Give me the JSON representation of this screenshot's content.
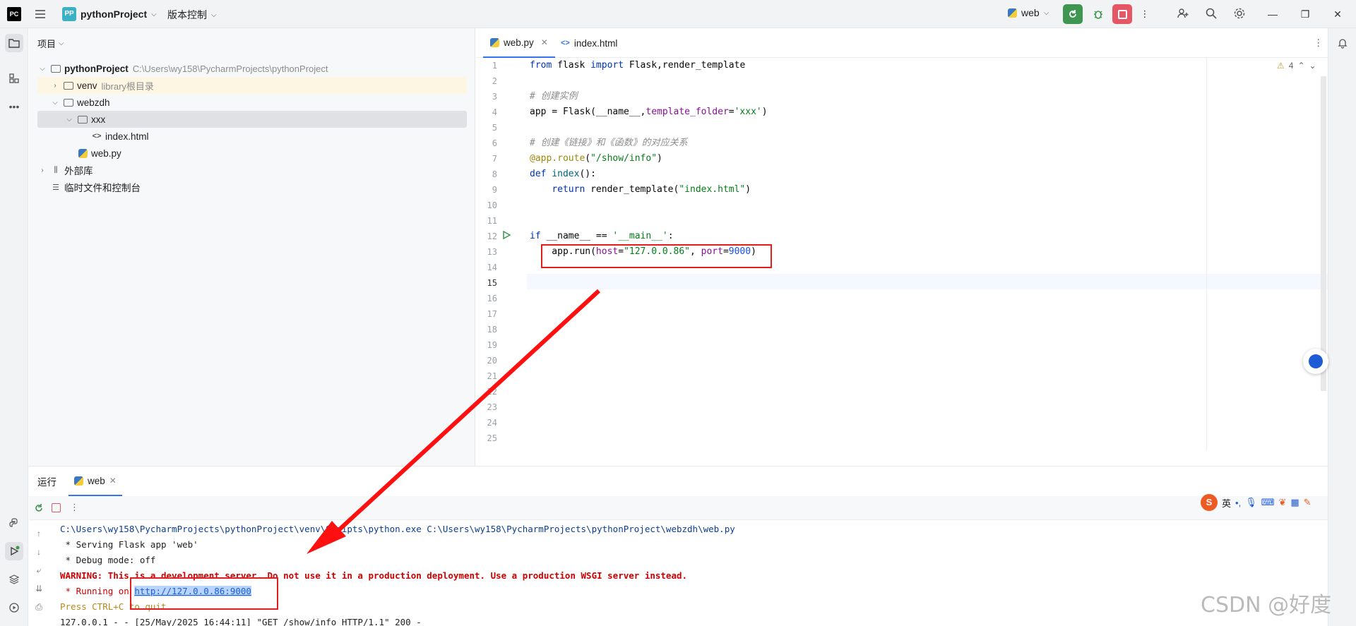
{
  "titlebar": {
    "logo": "PC",
    "project_badge": "PP",
    "project_name": "pythonProject",
    "vcs_label": "版本控制",
    "run_config": "web"
  },
  "project_panel": {
    "header": "项目",
    "tree": [
      {
        "label": "pythonProject",
        "hint": "C:\\Users\\wy158\\PycharmProjects\\pythonProject"
      },
      {
        "label": "venv",
        "hint": "library根目录"
      },
      {
        "label": "webzdh",
        "hint": ""
      },
      {
        "label": "xxx",
        "hint": ""
      },
      {
        "label": "index.html",
        "hint": ""
      },
      {
        "label": "web.py",
        "hint": ""
      },
      {
        "label": "外部库",
        "hint": ""
      },
      {
        "label": "临时文件和控制台",
        "hint": ""
      }
    ]
  },
  "editor": {
    "tabs": [
      {
        "label": "web.py",
        "active": true
      },
      {
        "label": "index.html",
        "active": false
      }
    ],
    "warnings_count": "4",
    "line_numbers": [
      "1",
      "2",
      "3",
      "4",
      "5",
      "6",
      "7",
      "8",
      "9",
      "10",
      "11",
      "12",
      "13",
      "14",
      "15",
      "16",
      "17",
      "18",
      "19",
      "20",
      "21",
      "22",
      "23",
      "24",
      "25"
    ],
    "code": {
      "l1_a": "from",
      "l1_b": " flask ",
      "l1_c": "import",
      "l1_d": " Flask,render_template",
      "l3": "# 创建实例",
      "l4_a": "app = Flask(__name__,",
      "l4_b": "template_folder",
      "l4_c": "=",
      "l4_d": "'xxx'",
      "l4_e": ")",
      "l6": "# 创建《链接》和《函数》的对应关系",
      "l7_a": "@app.route",
      "l7_b": "(",
      "l7_c": "\"/show/info\"",
      "l7_d": ")",
      "l8_a": "def",
      "l8_b": " index",
      "l8_c": "():",
      "l9_a": "    ",
      "l9_b": "return",
      "l9_c": " render_template(",
      "l9_d": "\"index.html\"",
      "l9_e": ")",
      "l12_a": "if",
      "l12_b": " __name__ == ",
      "l12_c": "'__main__'",
      "l12_d": ":",
      "l13_a": "    app.run(",
      "l13_b": "host",
      "l13_c": "=",
      "l13_d": "\"127.0.0.86\"",
      "l13_e": ", ",
      "l13_f": "port",
      "l13_g": "=",
      "l13_h": "9000",
      "l13_i": ")"
    }
  },
  "run_panel": {
    "tab_run": "运行",
    "tab_web": "web",
    "console": {
      "line1": "C:\\Users\\wy158\\PycharmProjects\\pythonProject\\venv\\Scripts\\python.exe C:\\Users\\wy158\\PycharmProjects\\pythonProject\\webzdh\\web.py",
      "line2": " * Serving Flask app 'web'",
      "line3": " * Debug mode: off",
      "line4": "WARNING: This is a development server. Do not use it in a production deployment. Use a production WSGI server instead.",
      "line5_prefix": " * Running on ",
      "line5_link": "http://127.0.0.86:9000",
      "line6": "Press CTRL+C to quit",
      "line7": "127.0.0.1 - - [25/May/2025 16:44:11] \"GET /show/info HTTP/1.1\" 200 -"
    }
  },
  "ime": {
    "logo": "S",
    "lang": "英"
  },
  "watermark": "CSDN @好度",
  "colors": {
    "accent": "#3574f0",
    "run_green": "#3e9650",
    "stop_red": "#e55765",
    "annotation_red": "#e01e1e"
  }
}
